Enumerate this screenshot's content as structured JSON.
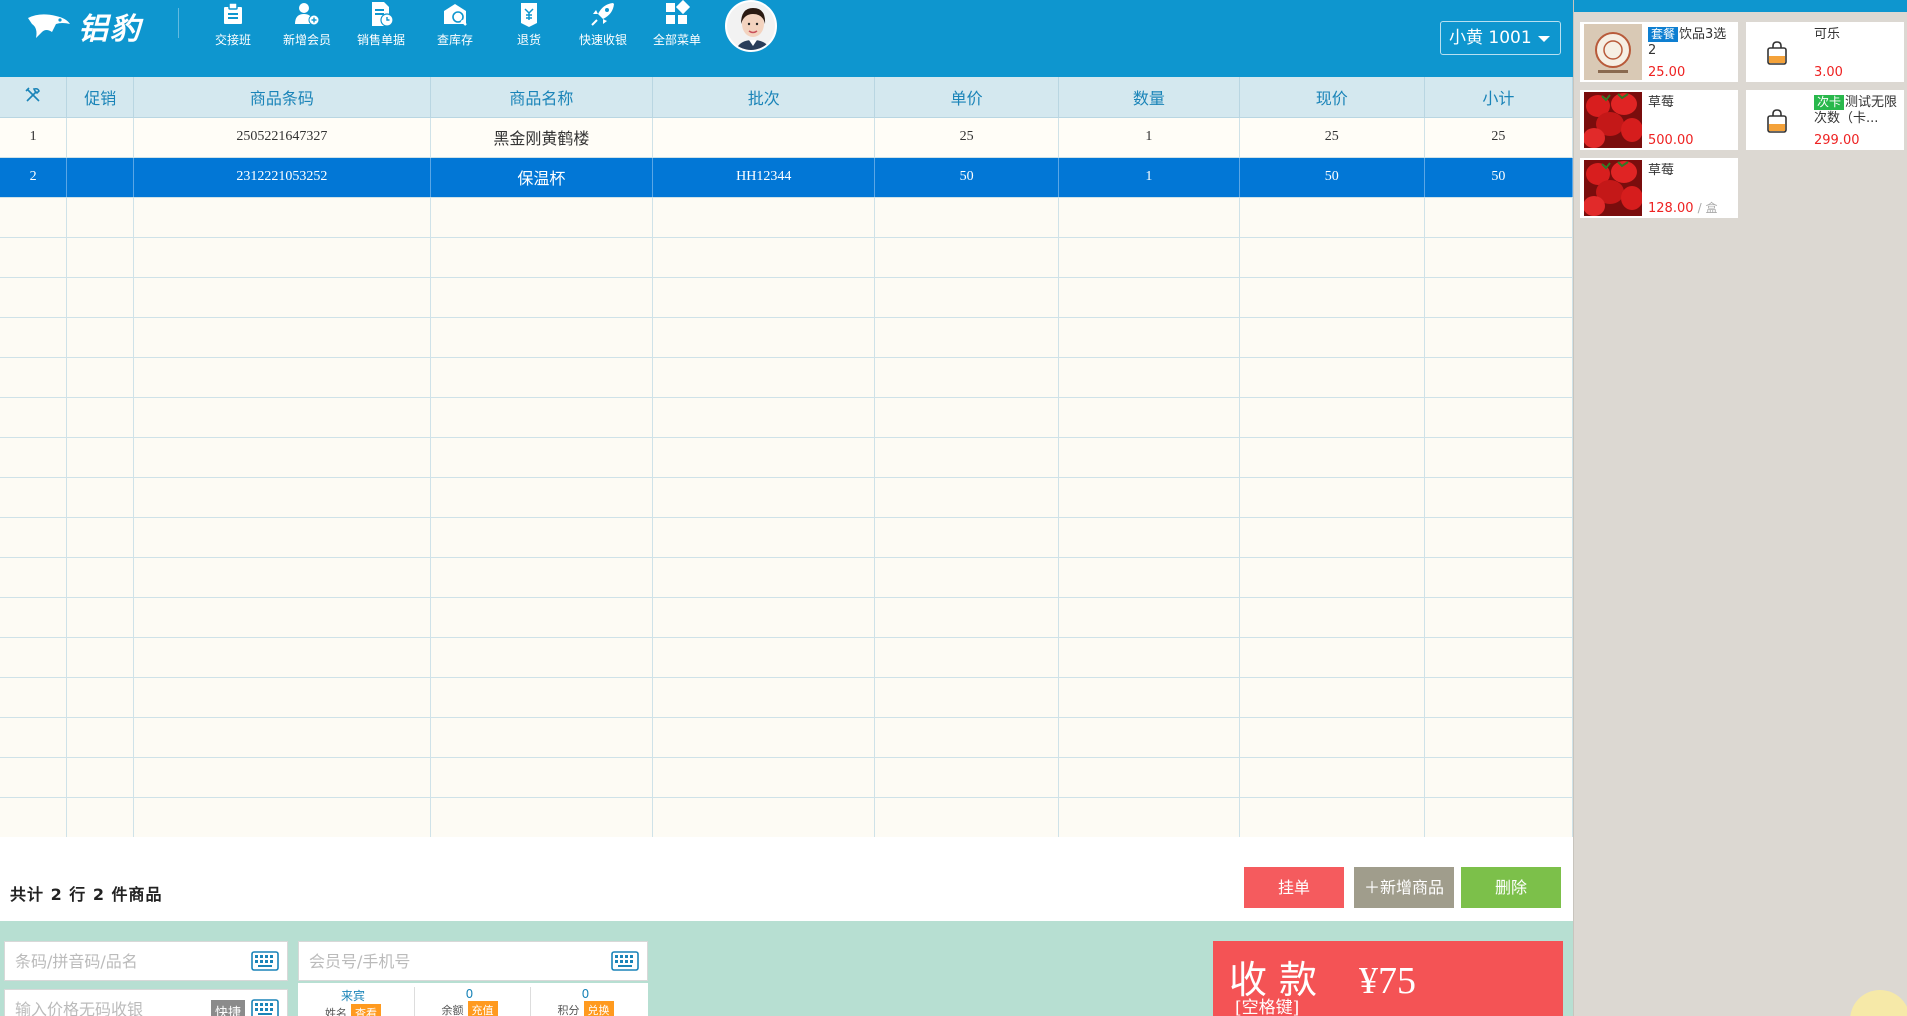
{
  "app": {
    "logo_text": "铝豹"
  },
  "toolbar": {
    "items": [
      {
        "label": "交接班",
        "icon": "handover-icon"
      },
      {
        "label": "新增会员",
        "icon": "add-member-icon"
      },
      {
        "label": "销售单据",
        "icon": "sales-doc-icon"
      },
      {
        "label": "查库存",
        "icon": "stock-query-icon"
      },
      {
        "label": "退货",
        "icon": "return-icon"
      },
      {
        "label": "快速收银",
        "icon": "quick-checkout-icon"
      },
      {
        "label": "全部菜单",
        "icon": "all-menu-icon"
      }
    ],
    "user_select": "小黄 1001"
  },
  "grid": {
    "headers": [
      "",
      "促销",
      "商品条码",
      "商品名称",
      "批次",
      "单价",
      "数量",
      "现价",
      "小计"
    ],
    "rows": [
      {
        "no": "1",
        "promo": "",
        "barcode": "2505221647327",
        "name": "黑金刚黄鹤楼",
        "batch": "",
        "unit_price": "25",
        "qty": "1",
        "price": "25",
        "subtotal": "25"
      },
      {
        "no": "2",
        "promo": "",
        "barcode": "2312221053252",
        "name": "保温杯",
        "batch": "HH12344",
        "unit_price": "50",
        "qty": "1",
        "price": "50",
        "subtotal": "50"
      }
    ],
    "selected_row": 1
  },
  "summary": {
    "text": "共计 2 行 2 件商品",
    "hold_label": "挂单",
    "add_label": "新增商品",
    "delete_label": "删除"
  },
  "bottom": {
    "barcode_placeholder": "条码/拼音码/品名",
    "price_placeholder": "输入价格无码收银",
    "quick_label": "快捷",
    "member_placeholder": "会员号/手机号",
    "member": {
      "name_value": "来宾",
      "name_key": "姓名",
      "name_tag": "查看",
      "balance_value": "0",
      "balance_key": "余额",
      "balance_tag": "充值",
      "points_value": "0",
      "points_key": "积分",
      "points_tag": "兑换"
    },
    "pay_label": "收款",
    "pay_hint": "[空格键]",
    "pay_amount": "¥75"
  },
  "products": [
    {
      "tag": "套餐",
      "tag_color": "#0e7fd1",
      "name": "饮品3选2",
      "price": "25.00",
      "unit": "",
      "thumb": "logo"
    },
    {
      "tag": "",
      "tag_color": "",
      "name": "可乐",
      "price": "3.00",
      "unit": "",
      "thumb": "bag"
    },
    {
      "tag": "",
      "tag_color": "",
      "name": "草莓",
      "price": "500.00",
      "unit": "",
      "thumb": "strawberry"
    },
    {
      "tag": "次卡",
      "tag_color": "#29b84c",
      "name": "测试无限次数（卡...",
      "price": "299.00",
      "unit": "",
      "thumb": "bag"
    },
    {
      "tag": "",
      "tag_color": "",
      "name": "草莓",
      "price": "128.00",
      "unit": "/ 盒",
      "thumb": "strawberry"
    }
  ],
  "colors": {
    "topbar": "#0e96cf",
    "selected_row": "#0277d6",
    "hold": "#f55b5e",
    "add": "#a09d8c",
    "delete": "#7cc04a",
    "pay": "#f45355"
  }
}
